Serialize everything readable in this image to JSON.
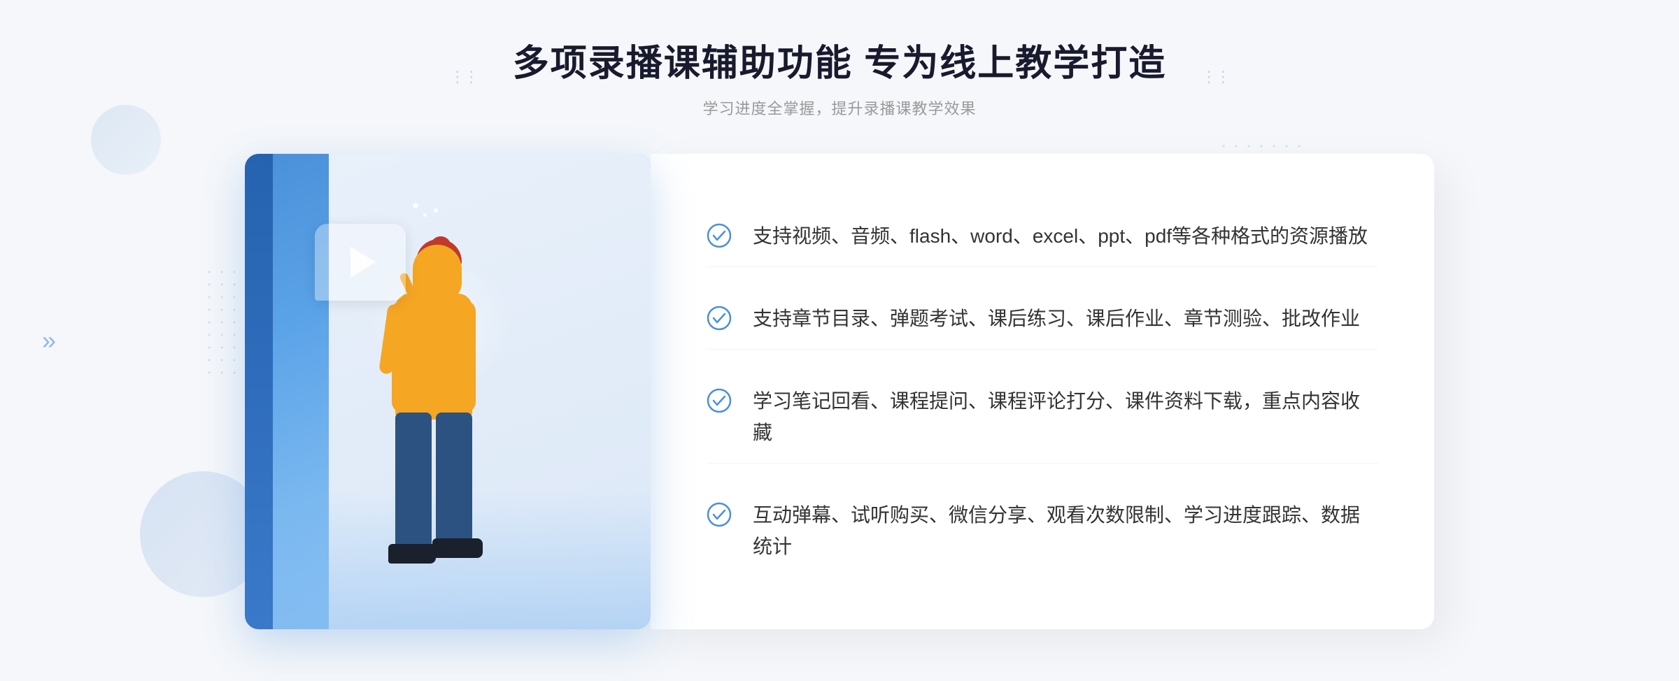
{
  "header": {
    "title": "多项录播课辅助功能 专为线上教学打造",
    "subtitle": "学习进度全掌握，提升录播课教学效果",
    "decoration_left": "⋮⋮",
    "decoration_right": "⋮⋮"
  },
  "features": [
    {
      "id": 1,
      "text": "支持视频、音频、flash、word、excel、ppt、pdf等各种格式的资源播放"
    },
    {
      "id": 2,
      "text": "支持章节目录、弹题考试、课后练习、课后作业、章节测验、批改作业"
    },
    {
      "id": 3,
      "text": "学习笔记回看、课程提问、课程评论打分、课件资料下载，重点内容收藏"
    },
    {
      "id": 4,
      "text": "互动弹幕、试听购买、微信分享、观看次数限制、学习进度跟踪、数据统计"
    }
  ],
  "colors": {
    "primary_blue": "#4a90d9",
    "dark_blue": "#2c5282",
    "text_dark": "#1a1a2e",
    "text_gray": "#999999",
    "text_body": "#333333",
    "check_color": "#4a90d9",
    "background": "#f5f7fa"
  },
  "arrows": {
    "left": "»",
    "header_left": "⋮⋮",
    "header_right": "⋮⋮"
  }
}
